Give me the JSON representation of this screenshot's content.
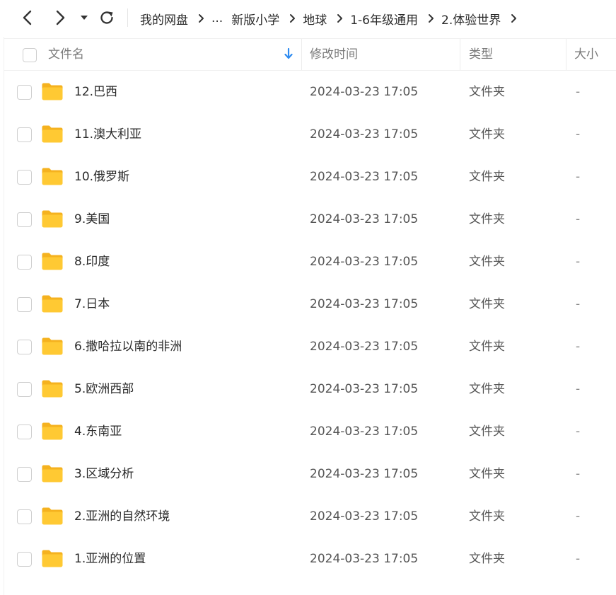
{
  "toolbar": {
    "icons": [
      "back-icon",
      "forward-icon",
      "history-dropdown-icon",
      "refresh-icon"
    ]
  },
  "breadcrumb": [
    "我的网盘",
    "...",
    "新版小学",
    "地球",
    "1-6年级通用",
    "2.体验世界"
  ],
  "columns": {
    "name": "文件名",
    "modified": "修改时间",
    "type": "类型",
    "size": "大小"
  },
  "colors": {
    "folder": "#FFC933",
    "folder_back": "#F5B21F",
    "sort_arrow": "#2E8BF0"
  },
  "files": [
    {
      "name": "12.巴西",
      "modified": "2024-03-23 17:05",
      "type": "文件夹",
      "size": "-"
    },
    {
      "name": "11.澳大利亚",
      "modified": "2024-03-23 17:05",
      "type": "文件夹",
      "size": "-"
    },
    {
      "name": "10.俄罗斯",
      "modified": "2024-03-23 17:05",
      "type": "文件夹",
      "size": "-"
    },
    {
      "name": "9.美国",
      "modified": "2024-03-23 17:05",
      "type": "文件夹",
      "size": "-"
    },
    {
      "name": "8.印度",
      "modified": "2024-03-23 17:05",
      "type": "文件夹",
      "size": "-"
    },
    {
      "name": "7.日本",
      "modified": "2024-03-23 17:05",
      "type": "文件夹",
      "size": "-"
    },
    {
      "name": "6.撒哈拉以南的非洲",
      "modified": "2024-03-23 17:05",
      "type": "文件夹",
      "size": "-"
    },
    {
      "name": "5.欧洲西部",
      "modified": "2024-03-23 17:05",
      "type": "文件夹",
      "size": "-"
    },
    {
      "name": "4.东南亚",
      "modified": "2024-03-23 17:05",
      "type": "文件夹",
      "size": "-"
    },
    {
      "name": "3.区域分析",
      "modified": "2024-03-23 17:05",
      "type": "文件夹",
      "size": "-"
    },
    {
      "name": "2.亚洲的自然环境",
      "modified": "2024-03-23 17:05",
      "type": "文件夹",
      "size": "-"
    },
    {
      "name": "1.亚洲的位置",
      "modified": "2024-03-23 17:05",
      "type": "文件夹",
      "size": "-"
    }
  ]
}
